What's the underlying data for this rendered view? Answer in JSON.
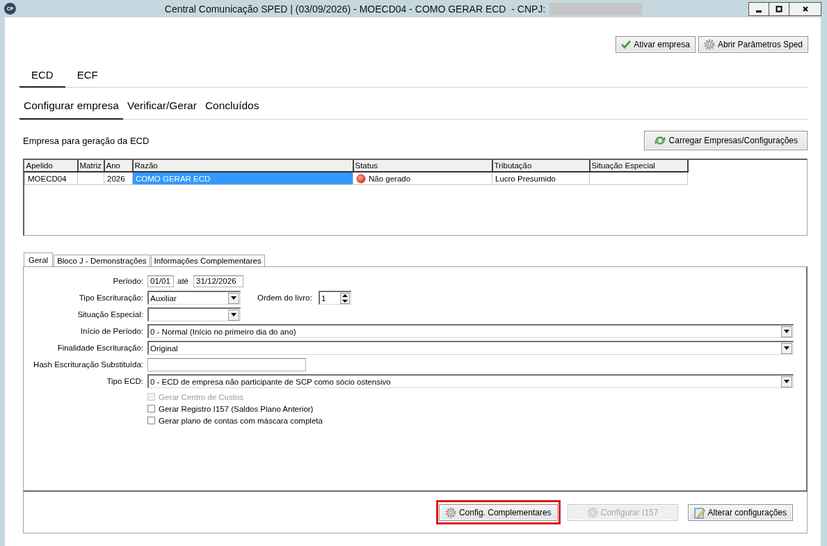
{
  "window": {
    "logo_text": "CP",
    "title": "Central Comunicação SPED | (03/09/2026) - MOECD04 - COMO GERAR ECD  - CNPJ:",
    "redacted": true
  },
  "toolbar": [
    {
      "label": "Ativar empresa",
      "kind": "check"
    },
    {
      "label": "Abrir Parâmetros Sped",
      "kind": "gear"
    }
  ],
  "main_tabs": [
    {
      "label": "ECD",
      "selected": true
    },
    {
      "label": "ECF",
      "selected": false
    }
  ],
  "sub_tabs": [
    {
      "label": "Configurar empresa",
      "selected": true
    },
    {
      "label": "Verificar/Gerar",
      "selected": false
    },
    {
      "label": "Concluídos",
      "selected": false
    }
  ],
  "section_title": "Empresa para geração da ECD",
  "load_button": {
    "label": "Carregar Empresas/Configurações"
  },
  "table": {
    "columns": [
      "Apelido",
      "Matriz",
      "Ano",
      "Razão",
      "Status",
      "Tributação",
      "Situação Especial"
    ],
    "rows": [
      {
        "cells": [
          "MOECD04",
          null,
          "2026",
          "COMO GERAR ECD",
          "Não gerado",
          "Lucro Presumido",
          null
        ],
        "selected": true
      }
    ]
  },
  "detail_tabs": [
    {
      "label": "Geral",
      "selected": true
    },
    {
      "label": "Bloco J - Demonstrações",
      "selected": false
    },
    {
      "label": "Informações Complementares",
      "selected": false
    }
  ],
  "form": [
    {
      "kind": "range",
      "label": "Período:",
      "from": "01/01",
      "joiner": "até",
      "to": "31/12/2026"
    },
    {
      "kind": "combo",
      "label": "Tipo Escrituração:",
      "value": "Auxiliar",
      "spinner": {
        "label": "Ordem do livro:",
        "value": "1"
      }
    },
    {
      "kind": "combo",
      "label": "Situação Especial:"
    },
    {
      "kind": "select",
      "label": "Início de Período:",
      "value": "0 - Normal (Início no primeiro dia do ano)"
    },
    {
      "kind": "select",
      "label": "Finalidade Escrituração:",
      "value": "Original"
    },
    {
      "kind": "text",
      "label": "Hash Escrituração Substituída:"
    },
    {
      "kind": "select",
      "label": "Tipo ECD:",
      "value": "0 - ECD de empresa não participante de SCP como sócio ostensivo"
    }
  ],
  "checkboxes": [
    {
      "label": "Gerar Centro de Custos",
      "checked": false,
      "disabled": true
    },
    {
      "label": "Gerar Registro I157 (Saldos Plano Anterior)",
      "checked": false,
      "disabled": false
    },
    {
      "label": "Gerar plano de contas com máscara completa",
      "checked": false,
      "disabled": false
    }
  ],
  "footer_buttons": [
    {
      "label": "Config. Complementares",
      "kind": "gear",
      "disabled": false,
      "highlighted": true
    },
    {
      "label": "Configurar I157",
      "kind": "gear",
      "disabled": true,
      "highlighted": false
    },
    {
      "label": "Alterar configurações",
      "kind": "edit",
      "disabled": false,
      "highlighted": false
    }
  ]
}
